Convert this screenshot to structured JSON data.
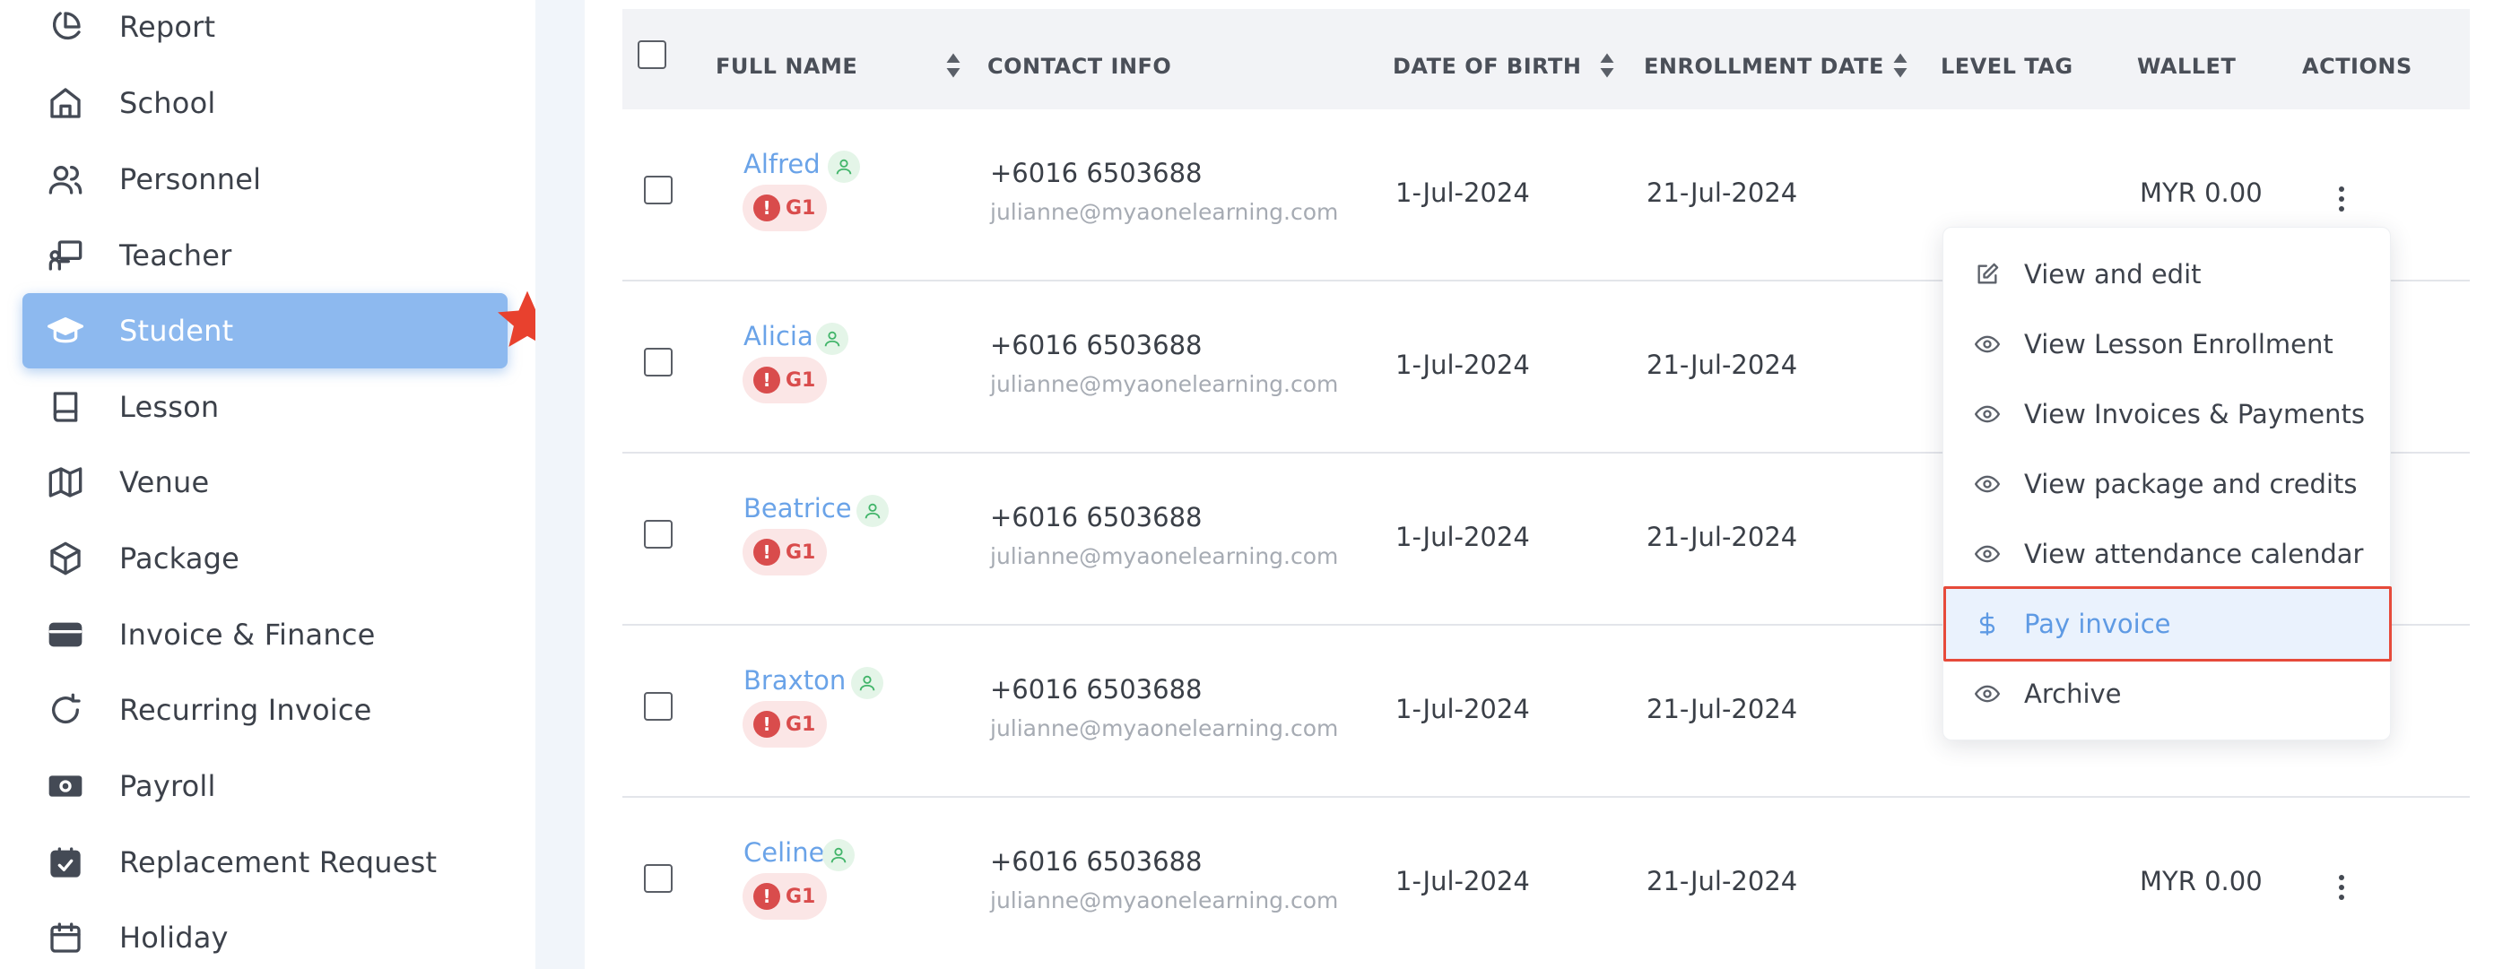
{
  "sidebar": {
    "items": [
      {
        "label": "Report",
        "icon": "pie-chart-icon"
      },
      {
        "label": "School",
        "icon": "home-icon"
      },
      {
        "label": "Personnel",
        "icon": "users-icon"
      },
      {
        "label": "Teacher",
        "icon": "teacher-icon"
      },
      {
        "label": "Student",
        "icon": "graduation-cap-icon",
        "active": true
      },
      {
        "label": "Lesson",
        "icon": "book-icon"
      },
      {
        "label": "Venue",
        "icon": "map-icon"
      },
      {
        "label": "Package",
        "icon": "box-icon"
      },
      {
        "label": "Invoice & Finance",
        "icon": "credit-card-icon"
      },
      {
        "label": "Recurring Invoice",
        "icon": "refresh-icon"
      },
      {
        "label": "Payroll",
        "icon": "cash-icon"
      },
      {
        "label": "Replacement Request",
        "icon": "calendar-check-icon"
      },
      {
        "label": "Holiday",
        "icon": "calendar-icon"
      }
    ],
    "active_color": "#8db9ef",
    "annotation_star_color": "#e8412e"
  },
  "table": {
    "headers": {
      "full_name": "FULL NAME",
      "contact_info": "CONTACT INFO",
      "date_of_birth": "DATE OF BIRTH",
      "enrollment_date": "ENROLLMENT DATE",
      "level_tag": "LEVEL TAG",
      "wallet": "WALLET",
      "actions": "ACTIONS"
    },
    "rows": [
      {
        "name": "Alfred",
        "level": "G1",
        "phone": "+6016  6503688",
        "email": "julianne@myaonelearning.com",
        "dob": "1-Jul-2024",
        "enrolled": "21-Jul-2024",
        "wallet": "MYR 0.00"
      },
      {
        "name": "Alicia",
        "level": "G1",
        "phone": "+6016  6503688",
        "email": "julianne@myaonelearning.com",
        "dob": "1-Jul-2024",
        "enrolled": "21-Jul-2024",
        "wallet": ""
      },
      {
        "name": "Beatrice",
        "level": "G1",
        "phone": "+6016  6503688",
        "email": "julianne@myaonelearning.com",
        "dob": "1-Jul-2024",
        "enrolled": "21-Jul-2024",
        "wallet": ""
      },
      {
        "name": "Braxton",
        "level": "G1",
        "phone": "+6016  6503688",
        "email": "julianne@myaonelearning.com",
        "dob": "1-Jul-2024",
        "enrolled": "21-Jul-2024",
        "wallet": ""
      },
      {
        "name": "Celine",
        "level": "G1",
        "phone": "+6016  6503688",
        "email": "julianne@myaonelearning.com",
        "dob": "1-Jul-2024",
        "enrolled": "21-Jul-2024",
        "wallet": "MYR 0.00"
      }
    ],
    "name_color": "#6aa3e8",
    "level_color": "#d94c4c",
    "alert_glyph": "!"
  },
  "action_menu": {
    "items": [
      {
        "label": "View and edit",
        "icon": "edit-icon"
      },
      {
        "label": "View Lesson Enrollment",
        "icon": "eye-icon"
      },
      {
        "label": "View Invoices & Payments",
        "icon": "eye-icon"
      },
      {
        "label": "View package and credits",
        "icon": "eye-icon"
      },
      {
        "label": "View attendance calendar",
        "icon": "eye-icon"
      },
      {
        "label": "Pay invoice",
        "icon": "dollar-icon",
        "highlighted": true
      },
      {
        "label": "Archive",
        "icon": "eye-icon"
      }
    ],
    "highlight_border_color": "#e64a3a"
  }
}
